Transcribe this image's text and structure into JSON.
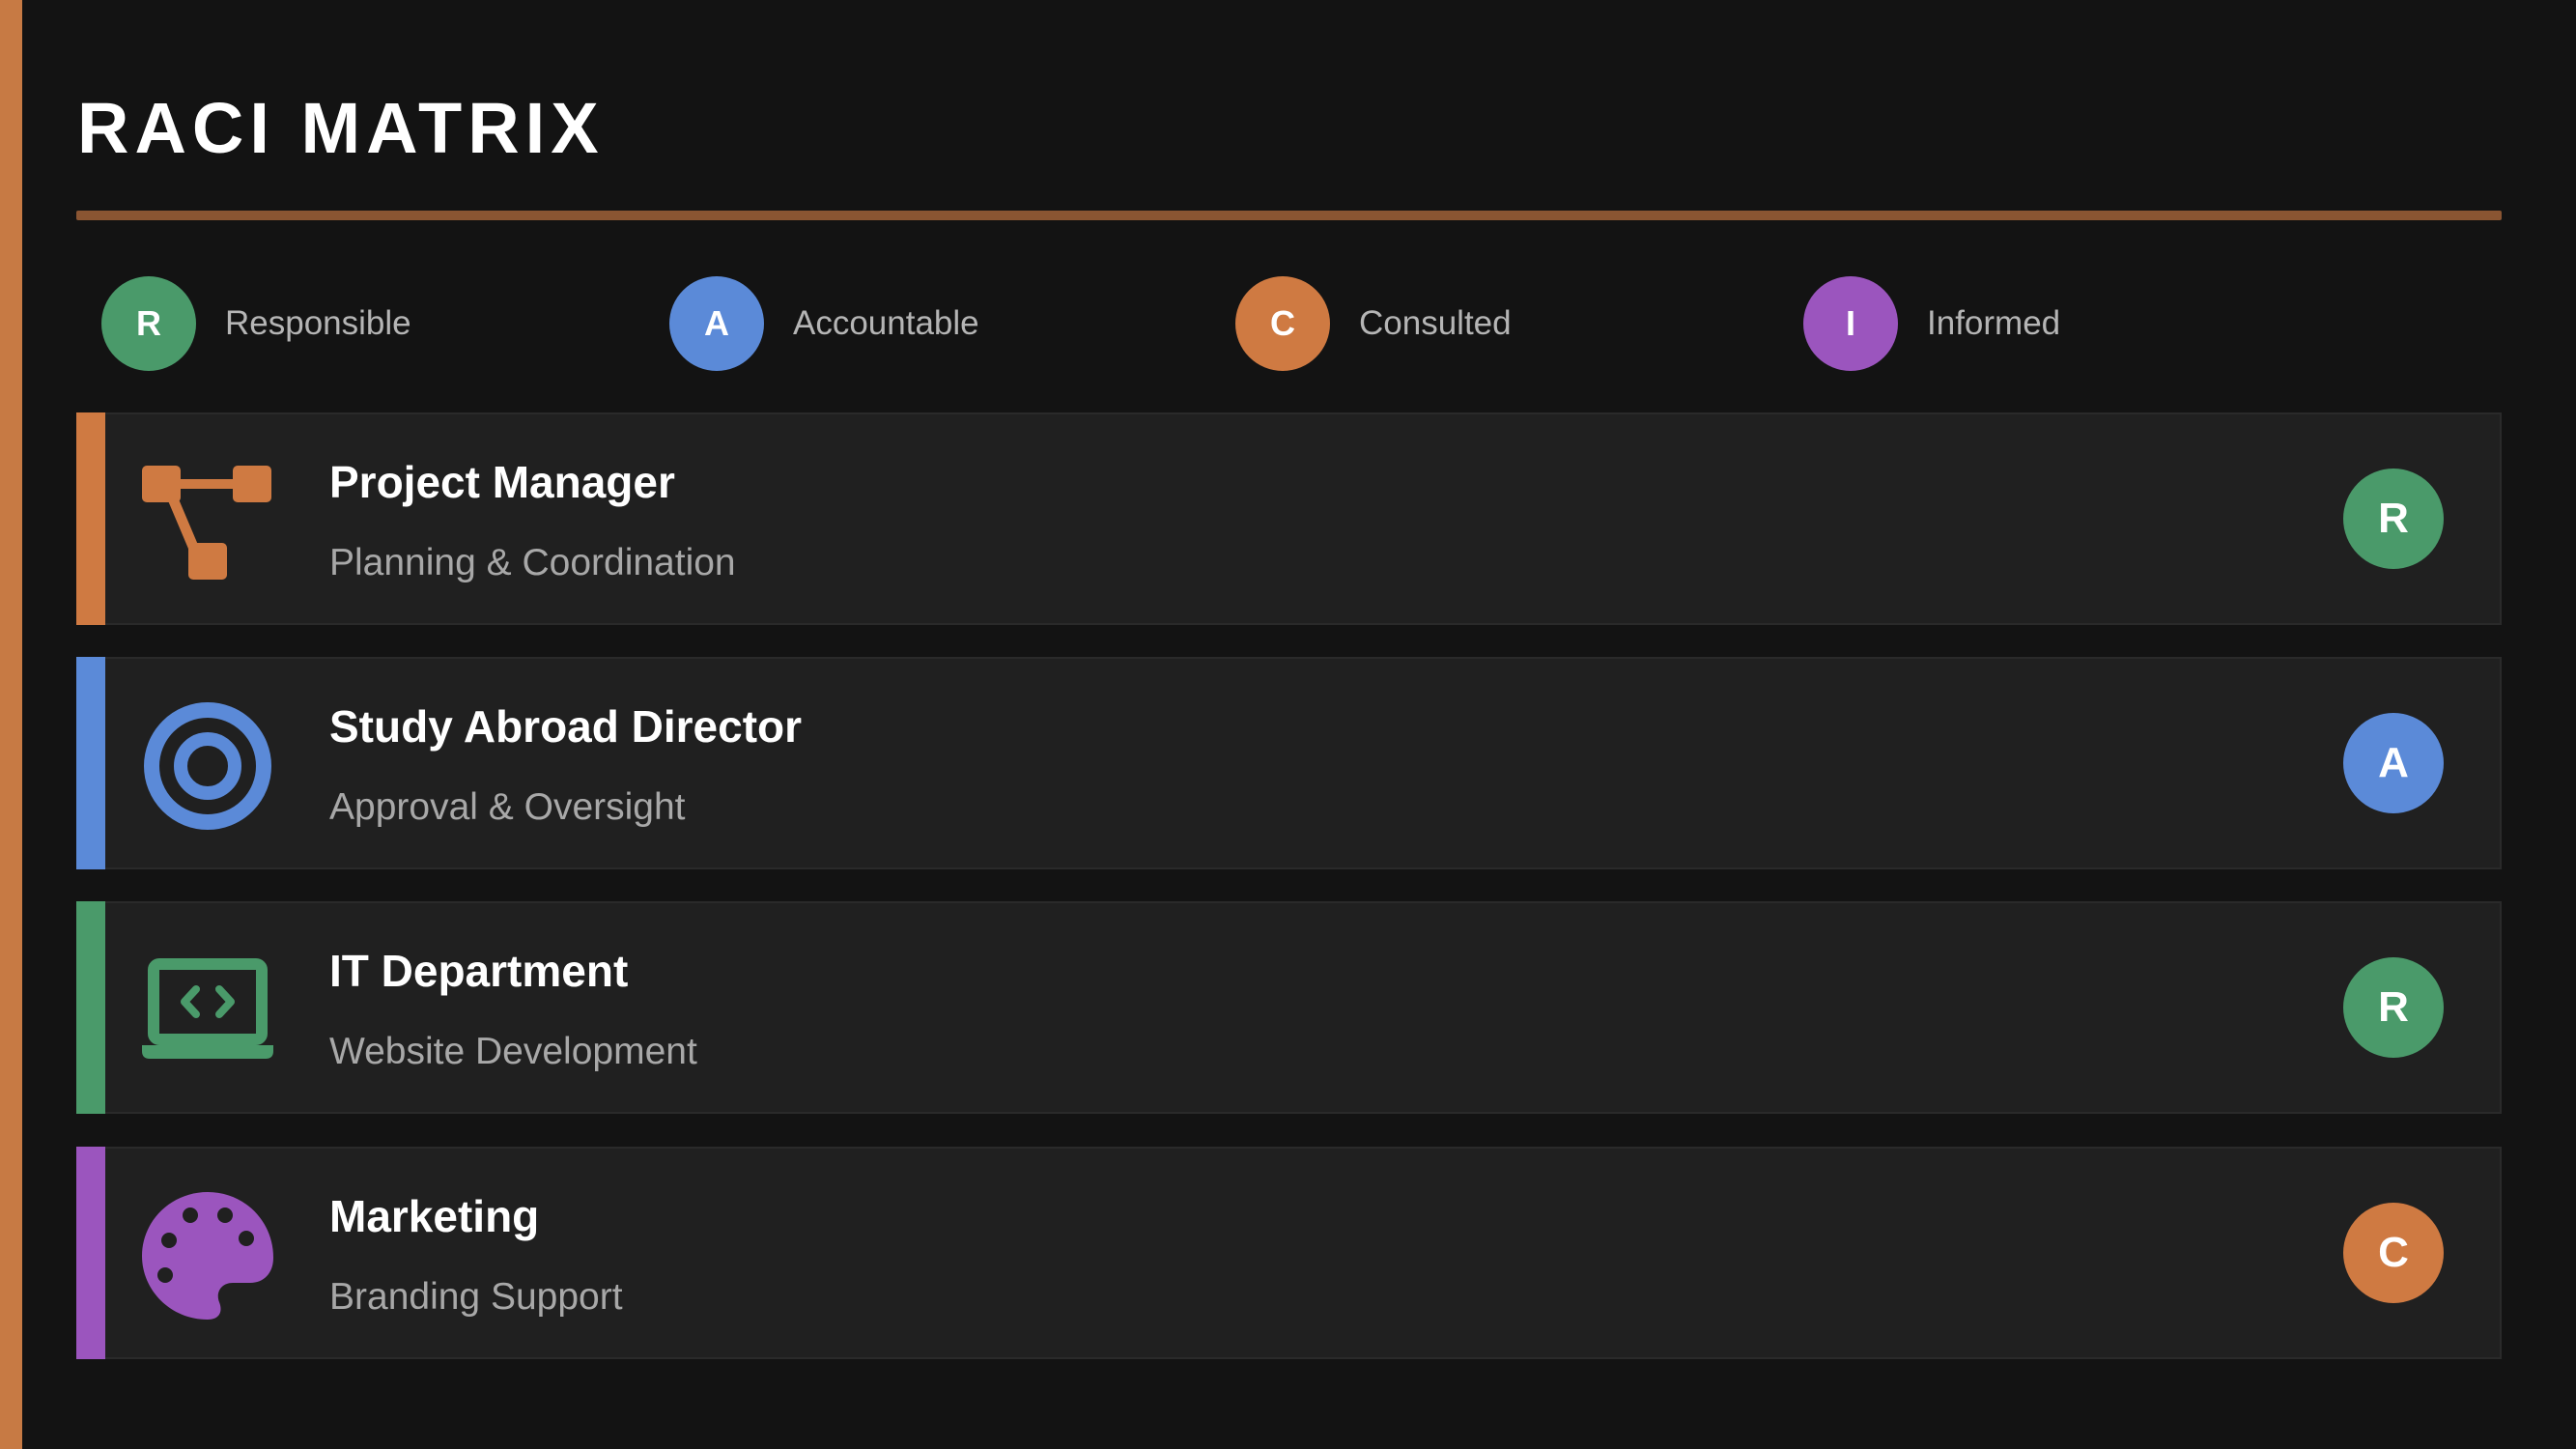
{
  "title": "RACI MATRIX",
  "colors": {
    "accent": "#c77a44",
    "rule": "#8a5532",
    "responsible": "#4a9a6a",
    "accountable": "#5b8ad8",
    "consulted": "#cf7a42",
    "informed": "#9b55be"
  },
  "legend": [
    {
      "letter": "R",
      "label": "Responsible",
      "color": "#4a9a6a"
    },
    {
      "letter": "A",
      "label": "Accountable",
      "color": "#5b8ad8"
    },
    {
      "letter": "C",
      "label": "Consulted",
      "color": "#cf7a42"
    },
    {
      "letter": "I",
      "label": "Informed",
      "color": "#9b55be"
    }
  ],
  "roles": [
    {
      "title": "Project Manager",
      "subtitle": "Planning & Coordination",
      "badge": "R",
      "icon": "hierarchy-icon",
      "accent": "#cf7a42",
      "badge_color": "#4a9a6a"
    },
    {
      "title": "Study Abroad Director",
      "subtitle": "Approval & Oversight",
      "badge": "A",
      "icon": "target-icon",
      "accent": "#5b8ad8",
      "badge_color": "#5b8ad8"
    },
    {
      "title": "IT Department",
      "subtitle": "Website Development",
      "badge": "R",
      "icon": "laptop-code-icon",
      "accent": "#4a9a6a",
      "badge_color": "#4a9a6a"
    },
    {
      "title": "Marketing",
      "subtitle": "Branding Support",
      "badge": "C",
      "icon": "palette-icon",
      "accent": "#9b55be",
      "badge_color": "#cf7a42"
    }
  ]
}
